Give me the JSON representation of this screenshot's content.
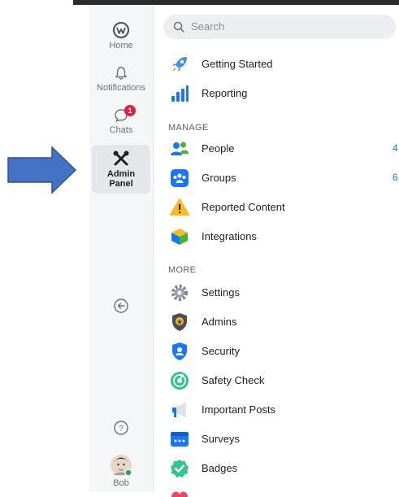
{
  "rail": {
    "items": [
      {
        "label": "Home"
      },
      {
        "label": "Notifications"
      },
      {
        "label": "Chats",
        "badge": "1"
      },
      {
        "label": "Admin\nPanel"
      }
    ],
    "user_name": "Bob"
  },
  "search": {
    "placeholder": "Search"
  },
  "nav": {
    "top": [
      {
        "label": "Getting Started",
        "icon": "rocket-icon"
      },
      {
        "label": "Reporting",
        "icon": "bar-chart-icon"
      }
    ],
    "manage_header": "MANAGE",
    "manage": [
      {
        "label": "People",
        "count": "4",
        "icon": "people-icon"
      },
      {
        "label": "Groups",
        "count": "6",
        "icon": "groups-icon"
      },
      {
        "label": "Reported Content",
        "icon": "warning-icon"
      },
      {
        "label": "Integrations",
        "icon": "cube-icon"
      }
    ],
    "more_header": "MORE",
    "more": [
      {
        "label": "Settings",
        "icon": "gear-icon"
      },
      {
        "label": "Admins",
        "icon": "admin-shield-icon"
      },
      {
        "label": "Security",
        "icon": "security-shield-icon"
      },
      {
        "label": "Safety Check",
        "icon": "safety-check-icon"
      },
      {
        "label": "Important Posts",
        "icon": "megaphone-icon"
      },
      {
        "label": "Surveys",
        "icon": "survey-icon"
      },
      {
        "label": "Badges",
        "icon": "badge-check-icon"
      }
    ]
  },
  "colors": {
    "arrow": "#4472c4",
    "accent": "#1a7de8",
    "notification": "#e41e3f"
  }
}
